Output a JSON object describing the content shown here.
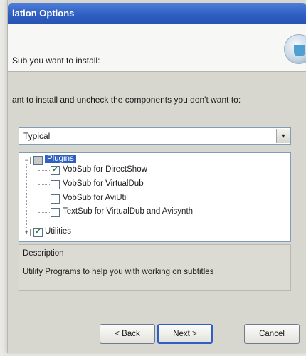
{
  "window": {
    "title": "lation Options"
  },
  "header": {
    "subtitle": "Sub you want to install:"
  },
  "instruction": "ant to install and uncheck the components you don't want to:",
  "install_type": {
    "value": "Typical"
  },
  "tree": {
    "root": {
      "label": "Plugins"
    },
    "children": [
      {
        "label": "VobSub for DirectShow",
        "checked": true
      },
      {
        "label": "VobSub for VirtualDub",
        "checked": false
      },
      {
        "label": "VobSub for AviUtil",
        "checked": false
      },
      {
        "label": "TextSub for VirtualDub and Avisynth",
        "checked": false
      }
    ],
    "utilities": {
      "label": "Utilities",
      "checked": true
    }
  },
  "description": {
    "legend": "Description",
    "text": "Utility Programs to help you with working on subtitles"
  },
  "buttons": {
    "back": "< Back",
    "next": "Next >",
    "cancel": "Cancel"
  }
}
